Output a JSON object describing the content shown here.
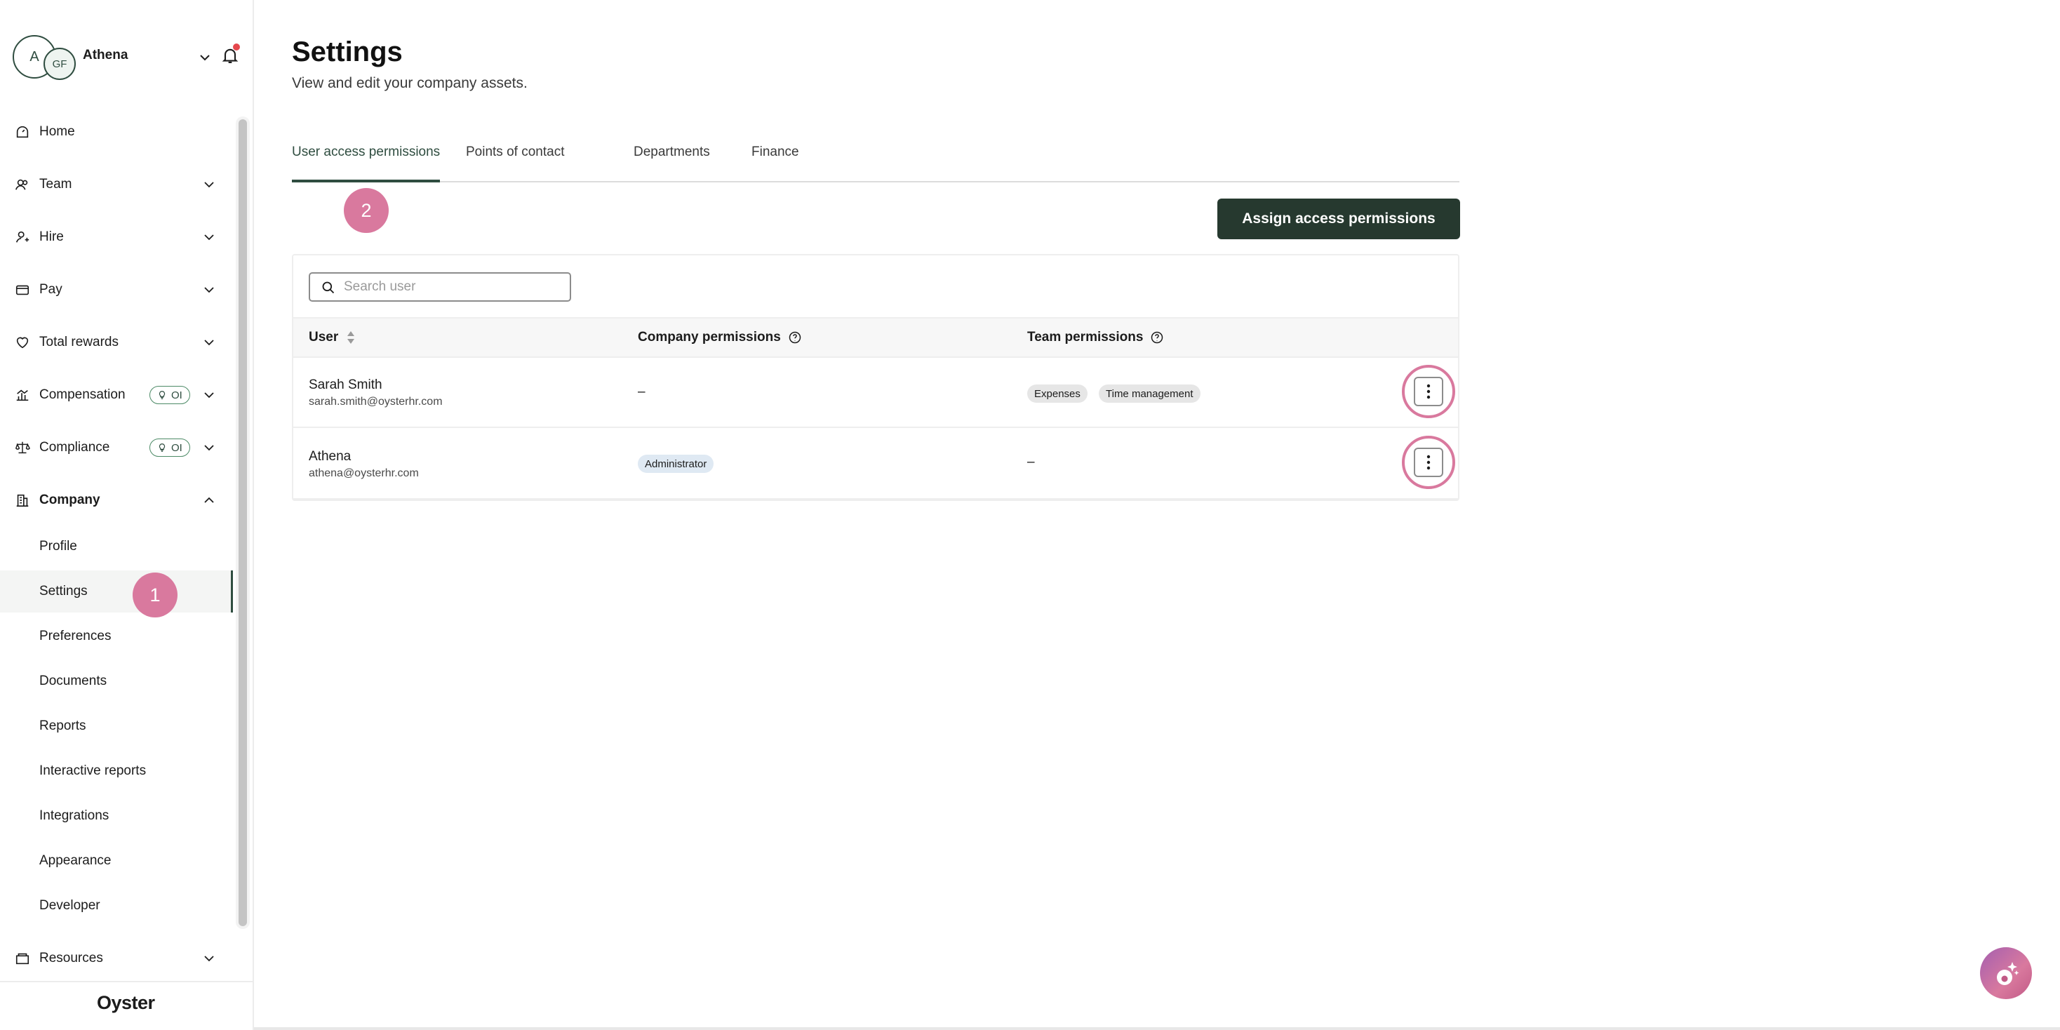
{
  "account": {
    "avatar_primary": "A",
    "avatar_secondary": "GF",
    "name": "Athena"
  },
  "sidebar": {
    "nav": [
      {
        "label": "Home",
        "icon": "home-icon"
      },
      {
        "label": "Team",
        "icon": "team-icon"
      },
      {
        "label": "Hire",
        "icon": "hire-icon"
      },
      {
        "label": "Pay",
        "icon": "pay-icon"
      },
      {
        "label": "Total rewards",
        "icon": "heart-icon"
      },
      {
        "label": "Compensation",
        "icon": "compensation-icon",
        "pill": "OI"
      },
      {
        "label": "Compliance",
        "icon": "scales-icon",
        "pill": "OI"
      },
      {
        "label": "Company",
        "icon": "building-icon"
      }
    ],
    "company_sub": [
      "Profile",
      "Settings",
      "Preferences",
      "Documents",
      "Reports",
      "Interactive reports",
      "Integrations",
      "Appearance",
      "Developer"
    ],
    "resources": {
      "label": "Resources",
      "icon": "resources-icon"
    },
    "active_sub": "Settings"
  },
  "annotations": {
    "step1": "1",
    "step2": "2"
  },
  "footer": {
    "logo": "Oyster"
  },
  "page": {
    "title": "Settings",
    "subtitle": "View and edit your company assets."
  },
  "tabs": [
    "User access permissions",
    "Points of contact",
    "Departments",
    "Finance"
  ],
  "active_tab": "User access permissions",
  "actions": {
    "assign": "Assign access permissions"
  },
  "search": {
    "placeholder": "Search user"
  },
  "table": {
    "headers": {
      "user": "User",
      "company": "Company permissions",
      "team": "Team permissions"
    },
    "rows": [
      {
        "name": "Sarah Smith",
        "email": "sarah.smith@oysterhr.com",
        "company": "–",
        "team_chips": [
          "Expenses",
          "Time management"
        ]
      },
      {
        "name": "Athena",
        "email": "athena@oysterhr.com",
        "company_chip": "Administrator",
        "team": "–"
      }
    ]
  },
  "colors": {
    "brand_dark": "#26392f",
    "accent_pink": "#d9799e",
    "active_tab": "#2f4d40"
  }
}
